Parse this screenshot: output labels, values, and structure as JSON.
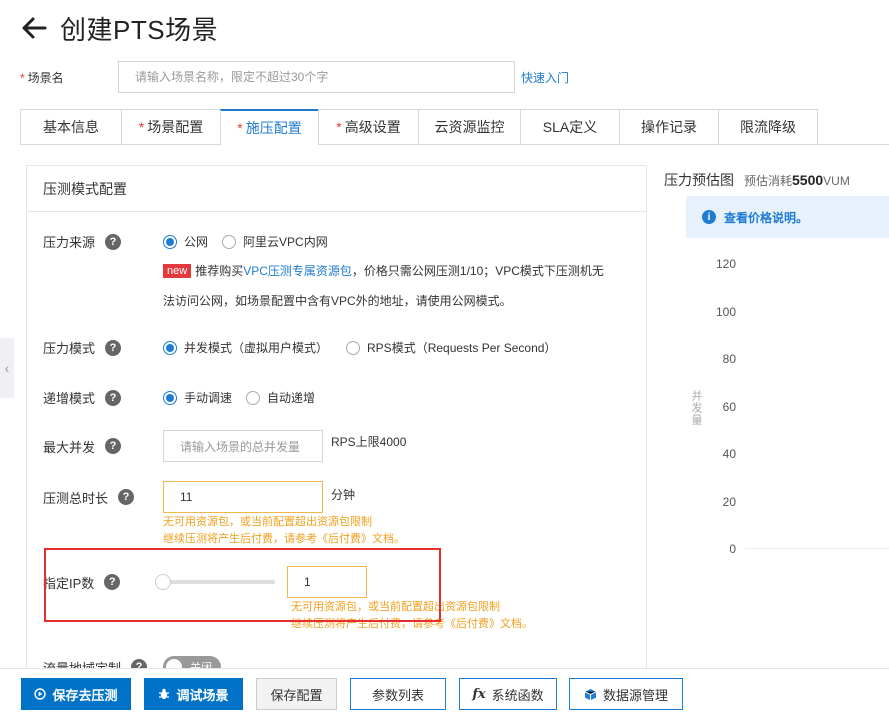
{
  "header": {
    "title": "创建PTS场景"
  },
  "scene": {
    "label": "场景名",
    "placeholder": "请输入场景名称，限定不超过30个字",
    "quick_link": "快速入门"
  },
  "tabs": [
    {
      "label": "基本信息",
      "required": false
    },
    {
      "label": "场景配置",
      "required": true
    },
    {
      "label": "施压配置",
      "required": true,
      "active": true
    },
    {
      "label": "高级设置",
      "required": true
    },
    {
      "label": "云资源监控",
      "required": false
    },
    {
      "label": "SLA定义",
      "required": false
    },
    {
      "label": "操作记录",
      "required": false
    },
    {
      "label": "限流降级",
      "required": false
    }
  ],
  "panel": {
    "title": "压测模式配置",
    "pressure_source": {
      "label": "压力来源",
      "options": [
        "公网",
        "阿里云VPC内网"
      ],
      "selected": 0,
      "badge": "new",
      "note_pre": "推荐购买",
      "note_link1": "VPC",
      "note_link2": "压测专属资源包",
      "note_post": "，价格只需公网压测1/10；VPC模式下压测机无",
      "note_line2": "法访问公网，如场景配置中含有VPC外的地址，请使用公网模式。"
    },
    "pressure_mode": {
      "label": "压力模式",
      "options": [
        "并发模式（虚拟用户模式）",
        "RPS模式（Requests Per Second）"
      ],
      "selected": 0
    },
    "ramp_mode": {
      "label": "递增模式",
      "options": [
        "手动调速",
        "自动递增"
      ],
      "selected": 0
    },
    "max_concurrency": {
      "label": "最大并发",
      "placeholder": "请输入场景的总并发量",
      "hint": "RPS上限4000"
    },
    "duration": {
      "label": "压测总时长",
      "value": "11",
      "unit": "分钟",
      "warn1": "无可用资源包，或当前配置超出资源包限制",
      "warn2_pre": "继续压测将产生后付费，请参考",
      "warn2_link": "《后付费》",
      "warn2_post": "文档。"
    },
    "ip_count": {
      "label": "指定IP数",
      "value": "1",
      "slider_value": 0,
      "warn1": "无可用资源包，或当前配置超出资源包限制",
      "warn2_pre": "继续压测将产生后付费，请参考",
      "warn2_link": "《后付费》",
      "warn2_post": "文档。"
    },
    "traffic_region": {
      "label": "流量地域定制",
      "toggle_text": "关闭"
    }
  },
  "side": {
    "title": "压力预估图",
    "cost_label": "预估消耗",
    "cost_value": "5500",
    "cost_unit": "VUM",
    "info": "查看价格说明。",
    "ylabel": "并发量",
    "yticks": [
      "120",
      "100",
      "80",
      "60",
      "40",
      "20",
      "0"
    ]
  },
  "footer": {
    "save_run": "保存去压测",
    "debug": "调试场景",
    "save": "保存配置",
    "params": "参数列表",
    "functions": "系统函数",
    "datasource": "数据源管理"
  },
  "colors": {
    "accent": "#1f7cd3",
    "warn": "#f0a020",
    "required": "#e4393c"
  }
}
